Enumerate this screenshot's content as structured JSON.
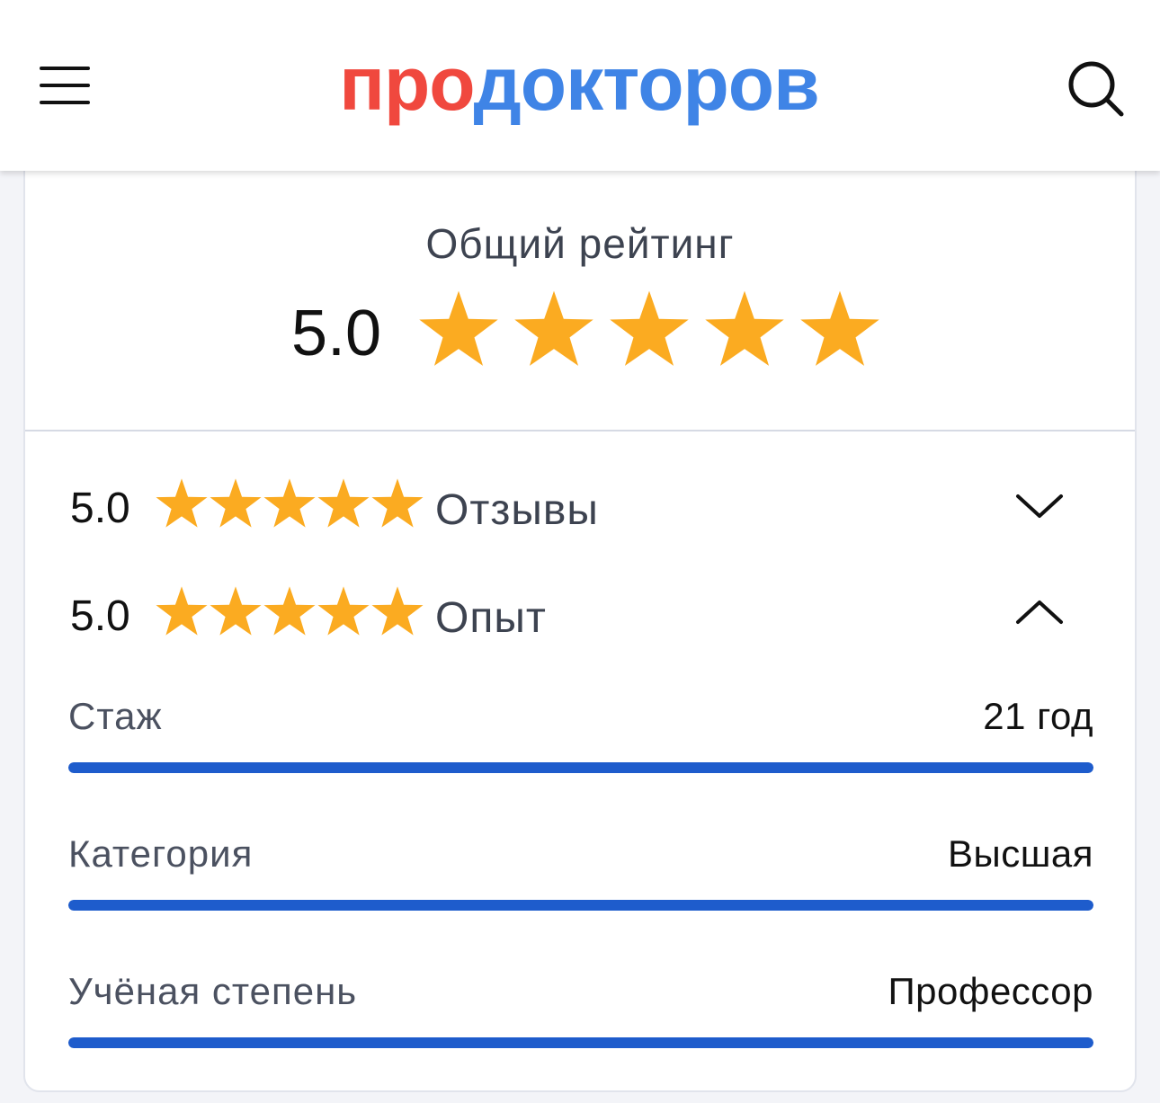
{
  "header": {
    "logo_part1": "про",
    "logo_part2": "докторов",
    "menu_icon": "hamburger-icon",
    "search_icon": "search-icon"
  },
  "colors": {
    "logo_red": "#f0483e",
    "logo_blue": "#3f84e6",
    "star": "#fbab21",
    "bar": "#1e5ccc"
  },
  "overall": {
    "title": "Общий рейтинг",
    "score": "5.0",
    "stars": 5
  },
  "ratings": [
    {
      "score": "5.0",
      "label": "Отзывы",
      "stars": 5,
      "expanded": false
    },
    {
      "score": "5.0",
      "label": "Опыт",
      "stars": 5,
      "expanded": true
    }
  ],
  "metrics": [
    {
      "label": "Стаж",
      "value": "21 год",
      "fill": 1.0
    },
    {
      "label": "Категория",
      "value": "Высшая",
      "fill": 1.0
    },
    {
      "label": "Учёная степень",
      "value": "Профессор",
      "fill": 1.0
    }
  ]
}
